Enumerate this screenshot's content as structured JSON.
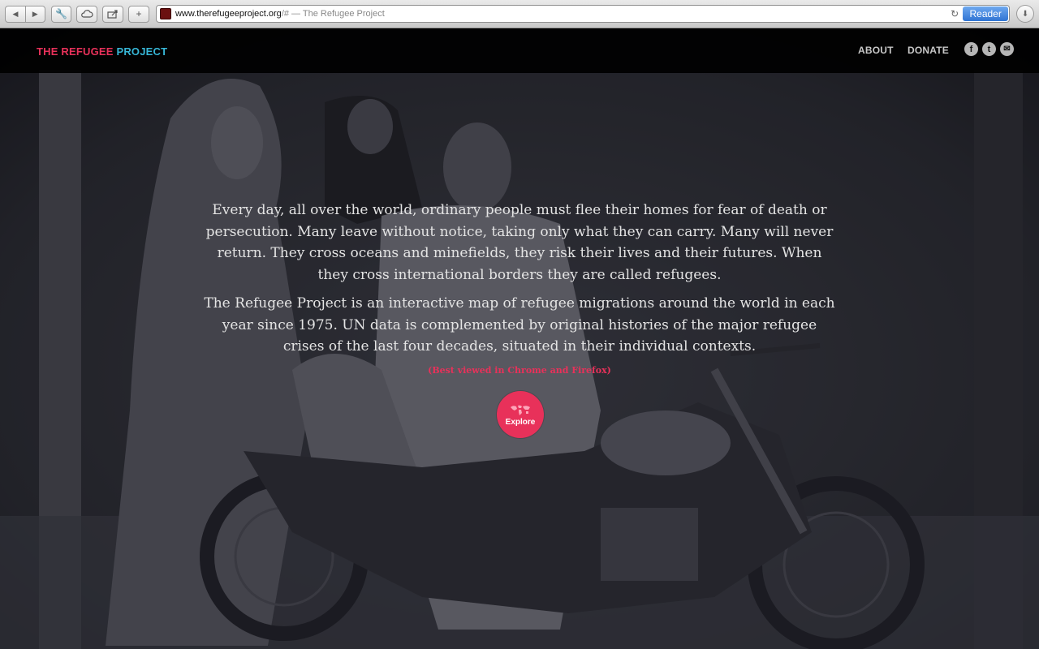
{
  "browser": {
    "url_main": "www.therefugeeproject.org",
    "url_rest": "/# — The Refugee Project",
    "reader_label": "Reader"
  },
  "header": {
    "logo_part1": "THE REFUGEE",
    "logo_part2": "PROJECT",
    "nav": {
      "about": "ABOUT",
      "donate": "DONATE"
    },
    "social": [
      {
        "icon": "facebook-icon",
        "glyph": "f"
      },
      {
        "icon": "twitter-icon",
        "glyph": "t"
      },
      {
        "icon": "email-icon",
        "glyph": "✉"
      }
    ]
  },
  "hero": {
    "paragraph1": "Every day, all over the world, ordinary people must flee their homes for fear of death or persecution. Many leave without notice, taking only what they can carry. Many will never return. They cross oceans and minefields, they risk their lives and their futures. When they cross international borders they are called refugees.",
    "paragraph2": "The Refugee Project is an interactive map of refugee migrations around the world in each year since 1975. UN data is complemented by original histories of the major refugee crises of the last four decades, situated in their individual contexts.",
    "note": "(Best viewed in Chrome and Firefox)",
    "explore_label": "Explore"
  },
  "colors": {
    "accent_red": "#e8315a",
    "accent_blue": "#37b6d6",
    "reader_blue": "#3b7fd9"
  }
}
